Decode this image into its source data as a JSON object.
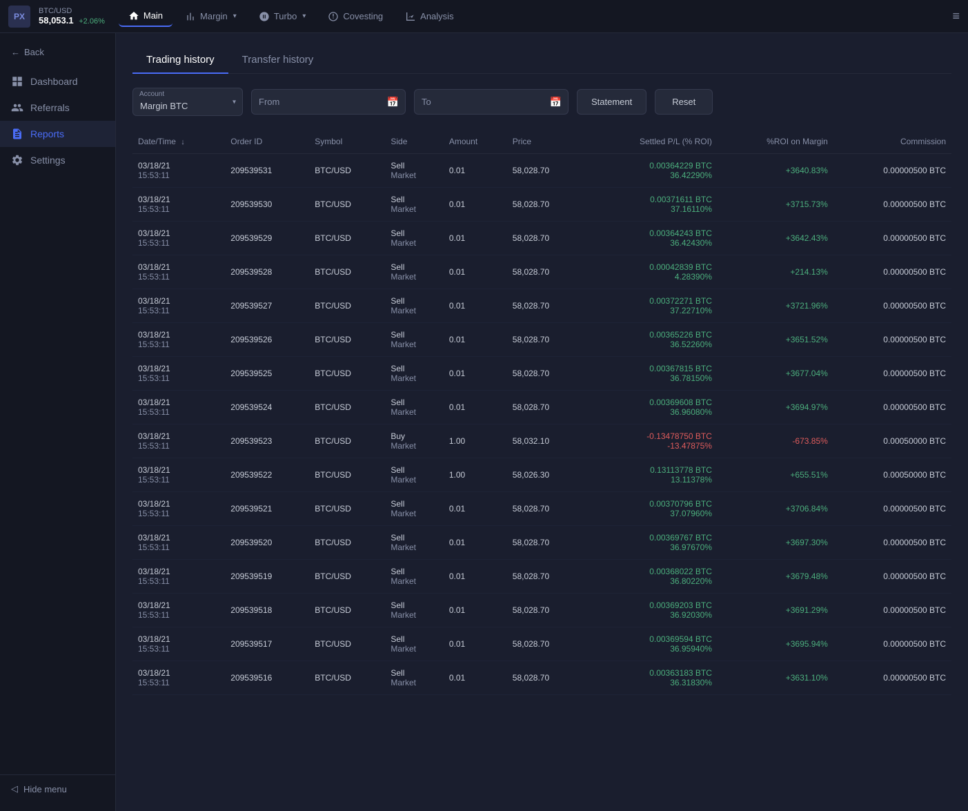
{
  "topbar": {
    "logo": "PX",
    "pair": "BTC/USD",
    "price": "58,053.1",
    "change": "+2.06%",
    "nav_items": [
      {
        "label": "Main",
        "active": true,
        "icon": "home-icon"
      },
      {
        "label": "Margin",
        "active": false,
        "has_arrow": true,
        "icon": "bar-chart-icon"
      },
      {
        "label": "Turbo",
        "active": false,
        "has_arrow": true,
        "icon": "turbo-icon"
      },
      {
        "label": "Covesting",
        "active": false,
        "icon": "covesting-icon"
      },
      {
        "label": "Analysis",
        "active": false,
        "icon": "analysis-icon"
      }
    ],
    "menu_icon": "≡"
  },
  "sidebar": {
    "back_label": "Back",
    "items": [
      {
        "label": "Dashboard",
        "icon": "dashboard-icon",
        "active": false
      },
      {
        "label": "Referrals",
        "icon": "referrals-icon",
        "active": false
      },
      {
        "label": "Reports",
        "icon": "reports-icon",
        "active": true
      },
      {
        "label": "Settings",
        "icon": "settings-icon",
        "active": false
      }
    ],
    "hide_menu_label": "Hide menu"
  },
  "tabs": [
    {
      "label": "Trading history",
      "active": true
    },
    {
      "label": "Transfer history",
      "active": false
    }
  ],
  "filters": {
    "account_label": "Account",
    "account_value": "Margin BTC",
    "from_placeholder": "From",
    "to_placeholder": "To",
    "statement_label": "Statement",
    "reset_label": "Reset"
  },
  "table": {
    "headers": [
      {
        "label": "Date/Time",
        "sortable": true
      },
      {
        "label": "Order ID"
      },
      {
        "label": "Symbol"
      },
      {
        "label": "Side"
      },
      {
        "label": "Amount"
      },
      {
        "label": "Price"
      },
      {
        "label": "Settled P/L (% ROI)",
        "align": "right"
      },
      {
        "label": "%ROI on Margin",
        "align": "right"
      },
      {
        "label": "Commission",
        "align": "right"
      }
    ],
    "rows": [
      {
        "datetime": "03/18/21\n15:53:11",
        "order_id": "209539531",
        "symbol": "BTC/USD",
        "side": "Sell\nMarket",
        "amount": "0.01",
        "price": "58,028.70",
        "pnl_btc": "0.00364229 BTC",
        "pnl_pct": "36.42290%",
        "roi_margin": "+3640.83%",
        "commission": "0.00000500 BTC",
        "pnl_positive": true
      },
      {
        "datetime": "03/18/21\n15:53:11",
        "order_id": "209539530",
        "symbol": "BTC/USD",
        "side": "Sell\nMarket",
        "amount": "0.01",
        "price": "58,028.70",
        "pnl_btc": "0.00371611 BTC",
        "pnl_pct": "37.16110%",
        "roi_margin": "+3715.73%",
        "commission": "0.00000500 BTC",
        "pnl_positive": true
      },
      {
        "datetime": "03/18/21\n15:53:11",
        "order_id": "209539529",
        "symbol": "BTC/USD",
        "side": "Sell\nMarket",
        "amount": "0.01",
        "price": "58,028.70",
        "pnl_btc": "0.00364243 BTC",
        "pnl_pct": "36.42430%",
        "roi_margin": "+3642.43%",
        "commission": "0.00000500 BTC",
        "pnl_positive": true
      },
      {
        "datetime": "03/18/21\n15:53:11",
        "order_id": "209539528",
        "symbol": "BTC/USD",
        "side": "Sell\nMarket",
        "amount": "0.01",
        "price": "58,028.70",
        "pnl_btc": "0.00042839 BTC",
        "pnl_pct": "4.28390%",
        "roi_margin": "+214.13%",
        "commission": "0.00000500 BTC",
        "pnl_positive": true
      },
      {
        "datetime": "03/18/21\n15:53:11",
        "order_id": "209539527",
        "symbol": "BTC/USD",
        "side": "Sell\nMarket",
        "amount": "0.01",
        "price": "58,028.70",
        "pnl_btc": "0.00372271 BTC",
        "pnl_pct": "37.22710%",
        "roi_margin": "+3721.96%",
        "commission": "0.00000500 BTC",
        "pnl_positive": true
      },
      {
        "datetime": "03/18/21\n15:53:11",
        "order_id": "209539526",
        "symbol": "BTC/USD",
        "side": "Sell\nMarket",
        "amount": "0.01",
        "price": "58,028.70",
        "pnl_btc": "0.00365226 BTC",
        "pnl_pct": "36.52260%",
        "roi_margin": "+3651.52%",
        "commission": "0.00000500 BTC",
        "pnl_positive": true
      },
      {
        "datetime": "03/18/21\n15:53:11",
        "order_id": "209539525",
        "symbol": "BTC/USD",
        "side": "Sell\nMarket",
        "amount": "0.01",
        "price": "58,028.70",
        "pnl_btc": "0.00367815 BTC",
        "pnl_pct": "36.78150%",
        "roi_margin": "+3677.04%",
        "commission": "0.00000500 BTC",
        "pnl_positive": true
      },
      {
        "datetime": "03/18/21\n15:53:11",
        "order_id": "209539524",
        "symbol": "BTC/USD",
        "side": "Sell\nMarket",
        "amount": "0.01",
        "price": "58,028.70",
        "pnl_btc": "0.00369608 BTC",
        "pnl_pct": "36.96080%",
        "roi_margin": "+3694.97%",
        "commission": "0.00000500 BTC",
        "pnl_positive": true
      },
      {
        "datetime": "03/18/21\n15:53:11",
        "order_id": "209539523",
        "symbol": "BTC/USD",
        "side": "Buy\nMarket",
        "amount": "1.00",
        "price": "58,032.10",
        "pnl_btc": "-0.13478750 BTC",
        "pnl_pct": "-13.47875%",
        "roi_margin": "-673.85%",
        "commission": "0.00050000 BTC",
        "pnl_positive": false
      },
      {
        "datetime": "03/18/21\n15:53:11",
        "order_id": "209539522",
        "symbol": "BTC/USD",
        "side": "Sell\nMarket",
        "amount": "1.00",
        "price": "58,026.30",
        "pnl_btc": "0.13113778 BTC",
        "pnl_pct": "13.11378%",
        "roi_margin": "+655.51%",
        "commission": "0.00050000 BTC",
        "pnl_positive": true
      },
      {
        "datetime": "03/18/21\n15:53:11",
        "order_id": "209539521",
        "symbol": "BTC/USD",
        "side": "Sell\nMarket",
        "amount": "0.01",
        "price": "58,028.70",
        "pnl_btc": "0.00370796 BTC",
        "pnl_pct": "37.07960%",
        "roi_margin": "+3706.84%",
        "commission": "0.00000500 BTC",
        "pnl_positive": true
      },
      {
        "datetime": "03/18/21\n15:53:11",
        "order_id": "209539520",
        "symbol": "BTC/USD",
        "side": "Sell\nMarket",
        "amount": "0.01",
        "price": "58,028.70",
        "pnl_btc": "0.00369767 BTC",
        "pnl_pct": "36.97670%",
        "roi_margin": "+3697.30%",
        "commission": "0.00000500 BTC",
        "pnl_positive": true
      },
      {
        "datetime": "03/18/21\n15:53:11",
        "order_id": "209539519",
        "symbol": "BTC/USD",
        "side": "Sell\nMarket",
        "amount": "0.01",
        "price": "58,028.70",
        "pnl_btc": "0.00368022 BTC",
        "pnl_pct": "36.80220%",
        "roi_margin": "+3679.48%",
        "commission": "0.00000500 BTC",
        "pnl_positive": true
      },
      {
        "datetime": "03/18/21\n15:53:11",
        "order_id": "209539518",
        "symbol": "BTC/USD",
        "side": "Sell\nMarket",
        "amount": "0.01",
        "price": "58,028.70",
        "pnl_btc": "0.00369203 BTC",
        "pnl_pct": "36.92030%",
        "roi_margin": "+3691.29%",
        "commission": "0.00000500 BTC",
        "pnl_positive": true
      },
      {
        "datetime": "03/18/21\n15:53:11",
        "order_id": "209539517",
        "symbol": "BTC/USD",
        "side": "Sell\nMarket",
        "amount": "0.01",
        "price": "58,028.70",
        "pnl_btc": "0.00369594 BTC",
        "pnl_pct": "36.95940%",
        "roi_margin": "+3695.94%",
        "commission": "0.00000500 BTC",
        "pnl_positive": true
      },
      {
        "datetime": "03/18/21\n15:53:11",
        "order_id": "209539516",
        "symbol": "BTC/USD",
        "side": "Sell\nMarket",
        "amount": "0.01",
        "price": "58,028.70",
        "pnl_btc": "0.00363183 BTC",
        "pnl_pct": "36.31830%",
        "roi_margin": "+3631.10%",
        "commission": "0.00000500 BTC",
        "pnl_positive": true
      }
    ]
  }
}
